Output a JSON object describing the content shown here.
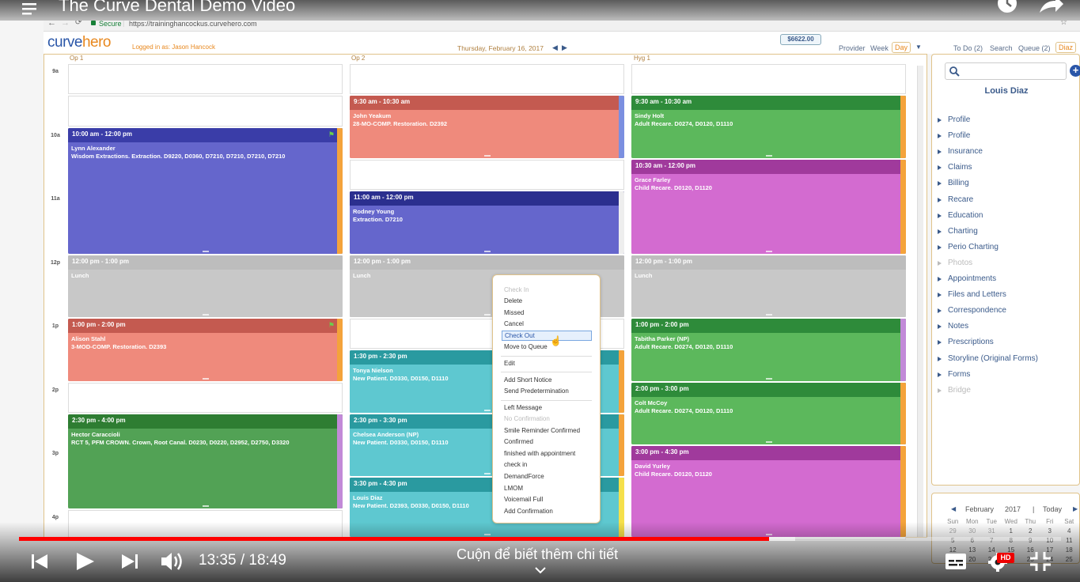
{
  "video": {
    "title": "The Curve Dental Demo Video",
    "time_current": "13:35",
    "time_total": "18:49",
    "time_sep": " / ",
    "progress": 0.72,
    "loaded": 0.745,
    "more_info": "Cuộn để biết thêm chi tiết",
    "hd_badge": "HD"
  },
  "browser": {
    "secure_label": "Secure",
    "url": "https://traininghancockus.curvehero.com"
  },
  "app": {
    "logo_curve": "curve",
    "logo_hero": "hero",
    "logged_in": "Logged in as: Jason Hancock",
    "date": "Thursday, February 16, 2017",
    "balance": "$6622.00",
    "view_tabs": [
      "Provider",
      "Week",
      "Day"
    ],
    "right_tabs": [
      "To Do (2)",
      "Search",
      "Queue (2)",
      "Diaz"
    ]
  },
  "calendar": {
    "columns": [
      "Op 1",
      "Op 2",
      "Hyg 1"
    ],
    "hours": [
      "9a",
      "10a",
      "11a",
      "12p",
      "1p",
      "2p",
      "3p",
      "4p"
    ],
    "appointments": [
      {
        "col": 0,
        "time": "10:00 am - 12:00 pm",
        "name": "Lynn Alexander",
        "desc": "Wisdom Extractions. Extraction. D9220, D0360, D7210, D7210, D7210, D7210"
      },
      {
        "col": 0,
        "time": "12:00 pm - 1:00 pm",
        "name": "Lunch",
        "desc": ""
      },
      {
        "col": 0,
        "time": "1:00 pm - 2:00 pm",
        "name": "Alison Stahl",
        "desc": "3-MOD-COMP. Restoration. D2393"
      },
      {
        "col": 0,
        "time": "2:30 pm - 4:00 pm",
        "name": "Hector Caraccioli",
        "desc": "RCT 5, PFM CROWN. Crown, Root Canal. D0230, D0220, D2952, D2750, D3320"
      },
      {
        "col": 1,
        "time": "9:30 am - 10:30 am",
        "name": "John Yeakum",
        "desc": "28-MO-COMP. Restoration. D2392"
      },
      {
        "col": 1,
        "time": "11:00 am - 12:00 pm",
        "name": "Rodney Young",
        "desc": "Extraction. D7210"
      },
      {
        "col": 1,
        "time": "12:00 pm - 1:00 pm",
        "name": "Lunch",
        "desc": ""
      },
      {
        "col": 1,
        "time": "1:30 pm - 2:30 pm",
        "name": "Tonya Nielson",
        "desc": "New Patient. D0330, D0150, D1110"
      },
      {
        "col": 1,
        "time": "2:30 pm - 3:30 pm",
        "name": "Chelsea Anderson (NP)",
        "desc": "New Patient. D0330, D0150, D1110"
      },
      {
        "col": 1,
        "time": "3:30 pm - 4:30 pm",
        "name": "Louis Diaz",
        "desc": "New Patient. D2393, D0330, D0150, D1110"
      },
      {
        "col": 2,
        "time": "9:30 am - 10:30 am",
        "name": "Sindy Holt",
        "desc": "Adult Recare. D0274, D0120, D1110"
      },
      {
        "col": 2,
        "time": "10:30 am - 12:00 pm",
        "name": "Grace Farley",
        "desc": "Child Recare. D0120, D1120"
      },
      {
        "col": 2,
        "time": "12:00 pm - 1:00 pm",
        "name": "Lunch",
        "desc": ""
      },
      {
        "col": 2,
        "time": "1:00 pm - 2:00 pm",
        "name": "Tabitha Parker (NP)",
        "desc": "Adult Recare. D0274, D0120, D1110"
      },
      {
        "col": 2,
        "time": "2:00 pm - 3:00 pm",
        "name": "Colt McCoy",
        "desc": "Adult Recare. D0274, D0120, D1110"
      },
      {
        "col": 2,
        "time": "3:00 pm - 4:30 pm",
        "name": "David Yurley",
        "desc": "Child Recare. D0120, D1120"
      }
    ]
  },
  "context_menu": {
    "items": [
      {
        "label": "Check In",
        "disabled": true
      },
      {
        "label": "Delete",
        "disabled": false
      },
      {
        "label": "Missed",
        "disabled": false
      },
      {
        "label": "Cancel",
        "disabled": false
      },
      {
        "label": "Check Out",
        "disabled": false,
        "highlighted": true
      },
      {
        "label": "Move to Queue",
        "disabled": false
      },
      {
        "label": "Edit",
        "disabled": false
      },
      {
        "label": "Add Short Notice",
        "disabled": false
      },
      {
        "label": "Send Predetermination",
        "disabled": false
      },
      {
        "label": "Left Message",
        "disabled": false
      },
      {
        "label": "No Confirmation",
        "disabled": true
      },
      {
        "label": "Smile Reminder Confirmed",
        "disabled": false
      },
      {
        "label": "Confirmed",
        "disabled": false
      },
      {
        "label": "finished with appointment",
        "disabled": false
      },
      {
        "label": "check in",
        "disabled": false
      },
      {
        "label": "DemandForce",
        "disabled": false
      },
      {
        "label": "LMOM",
        "disabled": false
      },
      {
        "label": "Voicemail Full",
        "disabled": false
      },
      {
        "label": "Add Confirmation",
        "disabled": false
      }
    ]
  },
  "patient_panel": {
    "name": "Louis Diaz",
    "nav": [
      {
        "label": "Profile",
        "disabled": false
      },
      {
        "label": "Profile",
        "disabled": false
      },
      {
        "label": "Insurance",
        "disabled": false
      },
      {
        "label": "Claims",
        "disabled": false
      },
      {
        "label": "Billing",
        "disabled": false
      },
      {
        "label": "Recare",
        "disabled": false
      },
      {
        "label": "Education",
        "disabled": false
      },
      {
        "label": "Charting",
        "disabled": false
      },
      {
        "label": "Perio Charting",
        "disabled": false
      },
      {
        "label": "Photos",
        "disabled": true
      },
      {
        "label": "Appointments",
        "disabled": false
      },
      {
        "label": "Files and Letters",
        "disabled": false
      },
      {
        "label": "Correspondence",
        "disabled": false
      },
      {
        "label": "Notes",
        "disabled": false
      },
      {
        "label": "Prescriptions",
        "disabled": false
      },
      {
        "label": "Storyline (Original Forms)",
        "disabled": false
      },
      {
        "label": "Forms",
        "disabled": false
      },
      {
        "label": "Bridge",
        "disabled": true
      }
    ]
  },
  "mini_calendar": {
    "month": "February",
    "year": "2017",
    "sep": "|",
    "today_label": "Today",
    "day_names": [
      "Sun",
      "Mon",
      "Tue",
      "Wed",
      "Thu",
      "Fri",
      "Sat"
    ],
    "days": [
      "29",
      "30",
      "31",
      "1",
      "2",
      "3",
      "4",
      "5",
      "6",
      "7",
      "8",
      "9",
      "10",
      "11",
      "12",
      "13",
      "14",
      "15",
      "16",
      "17",
      "18",
      "19",
      "20",
      "21",
      "22",
      "23",
      "24",
      "25"
    ]
  }
}
